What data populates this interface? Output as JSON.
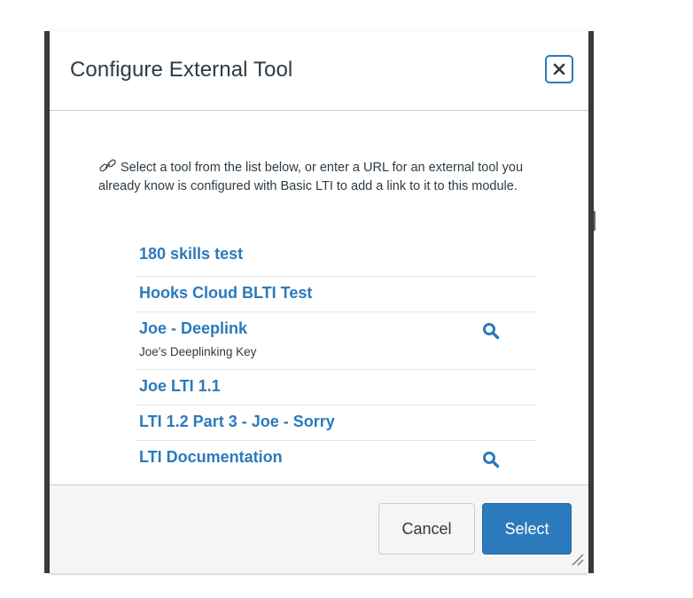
{
  "dialog": {
    "title": "Configure External Tool",
    "close_icon": "close-icon",
    "intro_icon": "link-icon",
    "intro_text": "Select a tool from the list below, or enter a URL for an external tool you already know is configured with Basic LTI to add a link to it to this module."
  },
  "tools": [
    {
      "name": "180 skills test",
      "description": "",
      "has_search": false
    },
    {
      "name": "Hooks Cloud BLTI Test",
      "description": "",
      "has_search": false
    },
    {
      "name": "Joe - Deeplink",
      "description": "Joe's Deeplinking Key",
      "has_search": true
    },
    {
      "name": "Joe LTI 1.1",
      "description": "",
      "has_search": false
    },
    {
      "name": "LTI 1.2 Part 3 - Joe - Sorry",
      "description": "",
      "has_search": false
    },
    {
      "name": "LTI Documentation",
      "description": "",
      "has_search": true
    }
  ],
  "footer": {
    "cancel_label": "Cancel",
    "select_label": "Select"
  },
  "colors": {
    "link": "#2b7abc",
    "text": "#2d3b45",
    "primary_button": "#2b7abc",
    "footer_bg": "#f5f5f5",
    "divider": "#c7cdd1"
  },
  "icons": {
    "search": "search-icon",
    "resize": "resize-handle-icon"
  }
}
